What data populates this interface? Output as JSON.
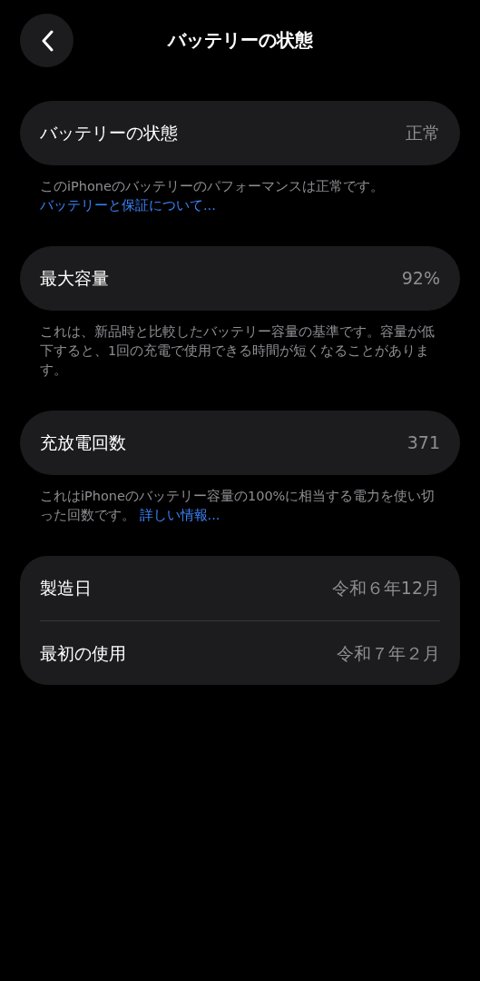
{
  "header": {
    "title": "バッテリーの状態"
  },
  "sections": [
    {
      "rows": [
        {
          "label": "バッテリーの状態",
          "value": "正常"
        }
      ],
      "footer": {
        "text": "このiPhoneのバッテリーのパフォーマンスは正常です。",
        "link": "バッテリーと保証について..."
      }
    },
    {
      "rows": [
        {
          "label": "最大容量",
          "value": "92%"
        }
      ],
      "footer": {
        "text": "これは、新品時と比較したバッテリー容量の基準です。容量が低下すると、1回の充電で使用できる時間が短くなることがあります。"
      }
    },
    {
      "rows": [
        {
          "label": "充放電回数",
          "value": "371"
        }
      ],
      "footer": {
        "text": "これはiPhoneのバッテリー容量の100%に相当する電力を使い切った回数です。",
        "link": "詳しい情報..."
      }
    },
    {
      "rows": [
        {
          "label": "製造日",
          "value": "令和６年12月"
        },
        {
          "label": "最初の使用",
          "value": "令和７年２月"
        }
      ]
    }
  ]
}
